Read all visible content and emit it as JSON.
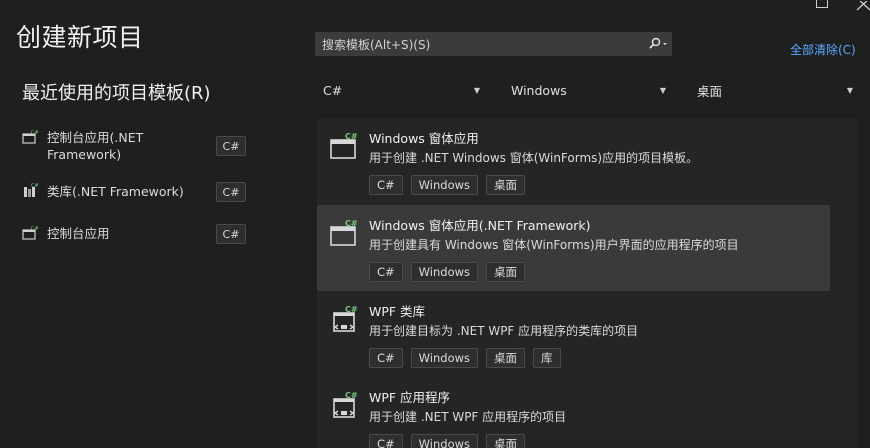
{
  "window": {
    "maximize_icon": "maximize-icon",
    "close_icon": "close-icon"
  },
  "header": {
    "title": "创建新项目"
  },
  "recent": {
    "title": "最近使用的项目模板(R)",
    "items": [
      {
        "label": "控制台应用(.NET Framework)",
        "tag": "C#",
        "icon": "console-app-icon"
      },
      {
        "label": "类库(.NET Framework)",
        "tag": "C#",
        "icon": "class-library-icon"
      },
      {
        "label": "控制台应用",
        "tag": "C#",
        "icon": "console-app-icon"
      }
    ]
  },
  "search": {
    "placeholder": "搜索模板(Alt+S)(S)",
    "icon": "search-icon"
  },
  "clear_all": "全部清除(C)",
  "filters": {
    "language": "C#",
    "platform": "Windows",
    "project_type": "桌面"
  },
  "templates": [
    {
      "name": "Windows 窗体应用",
      "desc": "用于创建 .NET Windows 窗体(WinForms)应用的项目模板。",
      "tags": [
        "C#",
        "Windows",
        "桌面"
      ],
      "selected": false
    },
    {
      "name": "Windows 窗体应用(.NET Framework)",
      "desc": "用于创建具有 Windows 窗体(WinForms)用户界面的应用程序的项目",
      "tags": [
        "C#",
        "Windows",
        "桌面"
      ],
      "selected": true
    },
    {
      "name": "WPF 类库",
      "desc": "用于创建目标为 .NET WPF 应用程序的类库的项目",
      "tags": [
        "C#",
        "Windows",
        "桌面",
        "库"
      ],
      "selected": false
    },
    {
      "name": "WPF 应用程序",
      "desc": "用于创建 .NET WPF 应用程序的项目",
      "tags": [
        "C#",
        "Windows",
        "桌面"
      ],
      "selected": false
    }
  ],
  "colors": {
    "accent_link": "#5aa9ff",
    "csharp_badge": "#7ec77e",
    "background": "#1f1f1f"
  }
}
